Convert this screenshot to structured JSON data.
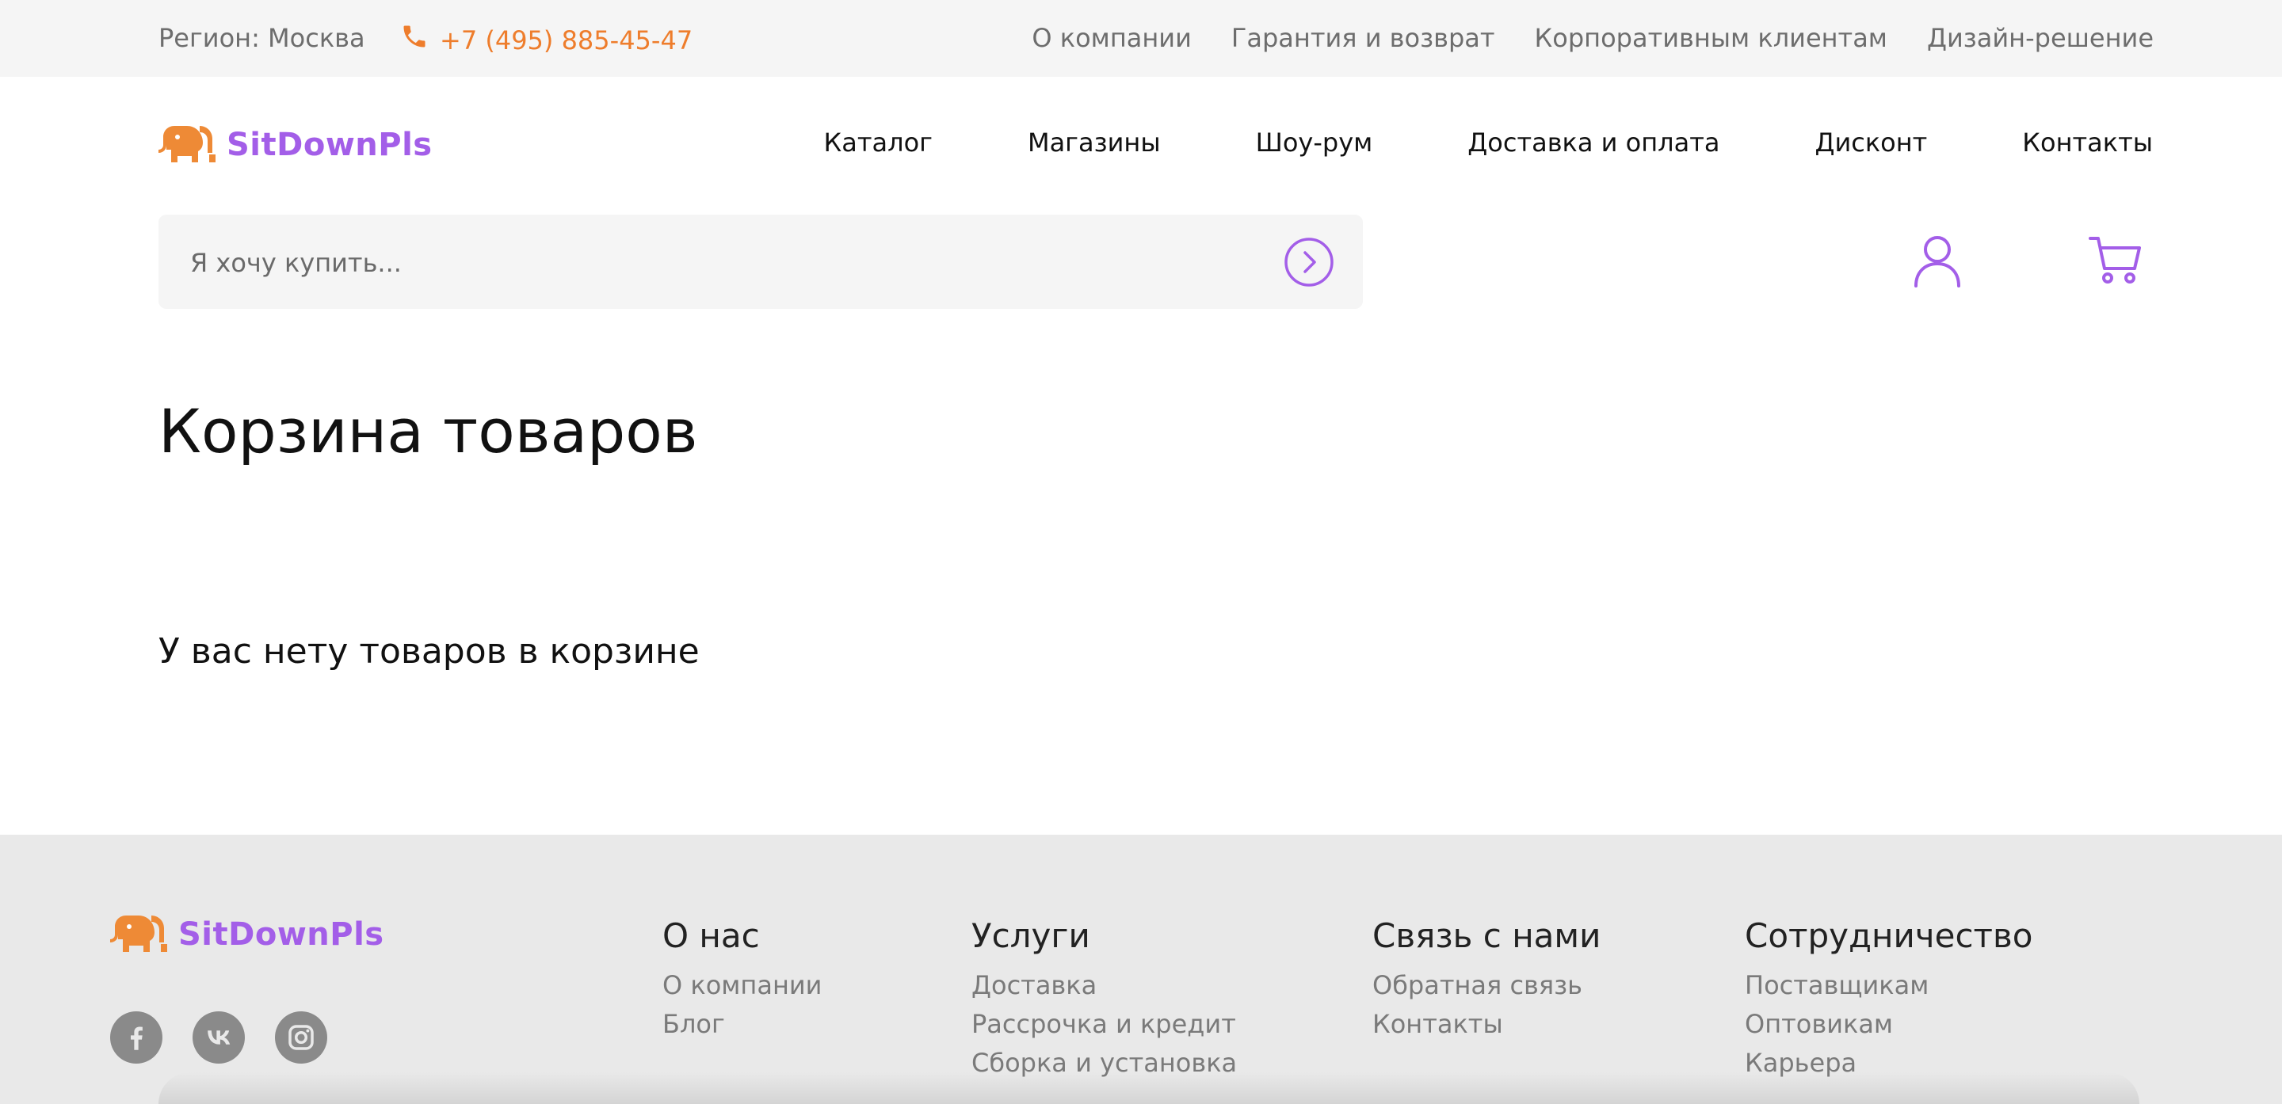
{
  "topbar": {
    "region": "Регион: Москва",
    "phone": "+7 (495) 885-45-47",
    "links": [
      "О компании",
      "Гарантия и возврат",
      "Корпоративным клиентам",
      "Дизайн-решение"
    ]
  },
  "header": {
    "logo_text": "SitDownPls",
    "nav": [
      "Каталог",
      "Магазины",
      "Шоу-рум",
      "Доставка и оплата",
      "Дисконт",
      "Контакты"
    ]
  },
  "search": {
    "placeholder": "Я хочу купить..."
  },
  "main": {
    "title": "Корзина товаров",
    "empty_message": "У вас нету товаров в корзине"
  },
  "footer": {
    "logo_text": "SitDownPls",
    "social_icons": [
      "facebook-icon",
      "vk-icon",
      "instagram-icon"
    ],
    "columns": [
      {
        "title": "О нас",
        "links": [
          "О компании",
          "Блог"
        ]
      },
      {
        "title": "Услуги",
        "links": [
          "Доставка",
          "Рассрочка и кредит",
          "Сборка и установка"
        ]
      },
      {
        "title": "Связь с нами",
        "links": [
          "Обратная связь",
          "Контакты"
        ]
      },
      {
        "title": "Сотрудничество",
        "links": [
          "Поставщикам",
          "Оптовикам",
          "Карьера"
        ]
      }
    ]
  },
  "colors": {
    "accent_purple": "#a35ee8",
    "accent_orange": "#ee7d2c",
    "footer_bg": "#e9e9e9",
    "topbar_bg": "#f5f5f5"
  }
}
